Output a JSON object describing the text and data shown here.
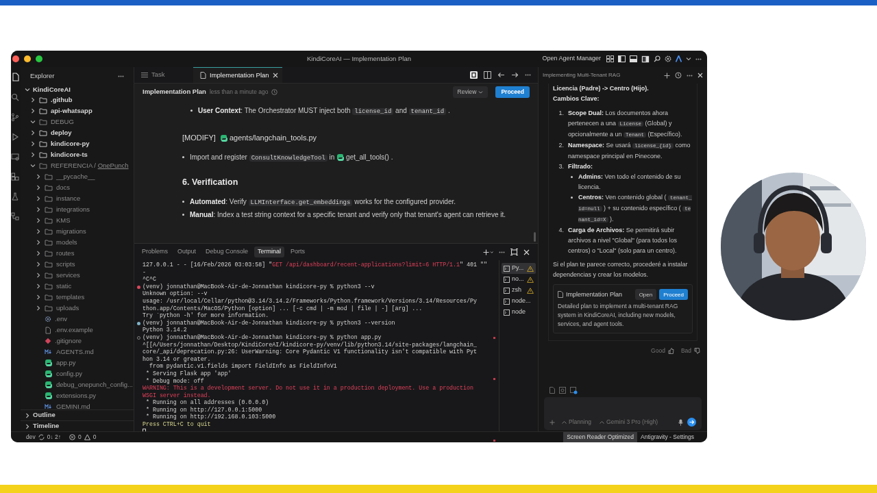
{
  "window": {
    "title": "KindiCoreAI — Implementation Plan",
    "agent_manager": "Open Agent Manager"
  },
  "explorer": {
    "title": "Explorer",
    "root": "KindiCoreAI",
    "items": [
      {
        "label": ".github",
        "kind": "folder",
        "expanded": false,
        "dimmed": false
      },
      {
        "label": "api-whatsapp",
        "kind": "folder",
        "expanded": false,
        "dimmed": false
      },
      {
        "label": "DEBUG",
        "kind": "folder",
        "expanded": true,
        "dimmed": true
      },
      {
        "label": "deploy",
        "kind": "folder",
        "expanded": false,
        "dimmed": false
      },
      {
        "label": "kindicore-py",
        "kind": "folder",
        "expanded": false,
        "dimmed": false
      },
      {
        "label": "kindicore-ts",
        "kind": "folder",
        "expanded": false,
        "dimmed": false
      },
      {
        "label": "REFERENCIA",
        "separator": "/",
        "link": "OnePunch",
        "kind": "folder",
        "expanded": true,
        "dimmed": true,
        "children": [
          {
            "label": "__pycache__",
            "kind": "folder",
            "expanded": false,
            "dimmed": true
          },
          {
            "label": "docs",
            "kind": "folder",
            "expanded": false,
            "dimmed": true
          },
          {
            "label": "instance",
            "kind": "folder",
            "expanded": false,
            "dimmed": true
          },
          {
            "label": "integrations",
            "kind": "folder",
            "expanded": false,
            "dimmed": true
          },
          {
            "label": "KMS",
            "kind": "folder",
            "expanded": false,
            "dimmed": true
          },
          {
            "label": "migrations",
            "kind": "folder",
            "expanded": false,
            "dimmed": true
          },
          {
            "label": "models",
            "kind": "folder",
            "expanded": false,
            "dimmed": true
          },
          {
            "label": "routes",
            "kind": "folder",
            "expanded": false,
            "dimmed": true
          },
          {
            "label": "scripts",
            "kind": "folder",
            "expanded": false,
            "dimmed": true
          },
          {
            "label": "services",
            "kind": "folder",
            "expanded": false,
            "dimmed": true
          },
          {
            "label": "static",
            "kind": "folder",
            "expanded": false,
            "dimmed": true
          },
          {
            "label": "templates",
            "kind": "folder",
            "expanded": false,
            "dimmed": true
          },
          {
            "label": "uploads",
            "kind": "folder",
            "expanded": false,
            "dimmed": true
          },
          {
            "label": ".env",
            "kind": "env",
            "dimmed": true
          },
          {
            "label": ".env.example",
            "kind": "file",
            "dimmed": true
          },
          {
            "label": ".gitignore",
            "kind": "git",
            "dimmed": true
          },
          {
            "label": "AGENTS.md",
            "kind": "markdown",
            "dimmed": true
          },
          {
            "label": "app.py",
            "kind": "python",
            "dimmed": true
          },
          {
            "label": "config.py",
            "kind": "python",
            "dimmed": true
          },
          {
            "label": "debug_onepunch_config...",
            "kind": "python",
            "dimmed": true
          },
          {
            "label": "extensions.py",
            "kind": "python",
            "dimmed": true
          },
          {
            "label": "GEMINI.md",
            "kind": "markdown",
            "dimmed": true
          }
        ]
      }
    ],
    "sections": [
      {
        "label": "Outline",
        "expanded": false
      },
      {
        "label": "Timeline",
        "expanded": false
      }
    ]
  },
  "editor": {
    "tabs": [
      {
        "label": "Task",
        "selected": false
      },
      {
        "label": "Implementation Plan",
        "selected": true
      }
    ],
    "header": {
      "title": "Implementation Plan",
      "time": "less than a minute ago",
      "review": "Review",
      "proceed": "Proceed"
    },
    "blocks": [
      {
        "kind": "sub_bullet",
        "segments": [
          {
            "t": "User Context",
            "kind": "bold"
          },
          {
            "t": ": The Orchestrator MUST inject both "
          },
          {
            "t": "license_id",
            "kind": "code"
          },
          {
            "t": " and "
          },
          {
            "t": "tenant_id",
            "kind": "code"
          },
          {
            "t": " ."
          }
        ]
      },
      {
        "kind": "file_heading",
        "segments": [
          {
            "t": "[MODIFY]"
          },
          {
            "t": "agents/langchain_tools.py",
            "kind": "file"
          }
        ]
      },
      {
        "kind": "bullet",
        "segments": [
          {
            "t": "Import and register "
          },
          {
            "t": "ConsultKnowledgeTool",
            "kind": "code"
          },
          {
            "t": " in "
          },
          {
            "t": "get_all_tools()",
            "kind": "file"
          },
          {
            "t": " ."
          }
        ]
      },
      {
        "kind": "heading",
        "segments": [
          {
            "t": "6. Verification"
          }
        ]
      },
      {
        "kind": "bullet",
        "segments": [
          {
            "t": "Automated",
            "kind": "bold"
          },
          {
            "t": ": Verify "
          },
          {
            "t": "LLMInterface.get_embeddings",
            "kind": "code"
          },
          {
            "t": " works for the configured provider."
          }
        ]
      },
      {
        "kind": "bullet",
        "segments": [
          {
            "t": "Manual",
            "kind": "bold"
          },
          {
            "t": ": Index a test string context for a specific tenant and verify only that tenant's agent can retrieve it."
          }
        ]
      }
    ]
  },
  "panel": {
    "tabs": [
      {
        "label": "Problems",
        "selected": false
      },
      {
        "label": "Output",
        "selected": false
      },
      {
        "label": "Debug Console",
        "selected": false
      },
      {
        "label": "Terminal",
        "selected": true
      },
      {
        "label": "Ports",
        "selected": false
      }
    ],
    "terminal_lines": [
      {
        "kind": "output",
        "segments": [
          {
            "t": "127.0.0.1 - - [16/Feb/2026 03:03:58] \""
          },
          {
            "t": "GET /api/dashboard/recent-applications?limit=6 HTTP/1.1",
            "kind": "error"
          },
          {
            "t": "\" 401 \"\""
          }
        ]
      },
      {
        "kind": "output",
        "segments": [
          {
            "t": "-"
          }
        ]
      },
      {
        "kind": "output",
        "segments": [
          {
            "t": "^C^C"
          }
        ]
      },
      {
        "kind": "prompt_failed",
        "segments": [
          {
            "t": "(venv) jonnathan@MacBook-Air-de-Jonnathan kindicore-py % python3 --v"
          }
        ]
      },
      {
        "kind": "output",
        "segments": [
          {
            "t": "Unknown option: --v"
          }
        ]
      },
      {
        "kind": "output",
        "segments": [
          {
            "t": "usage: /usr/local/Cellar/python@3.14/3.14.2/Frameworks/Python.framework/Versions/3.14/Resources/Py"
          }
        ]
      },
      {
        "kind": "output",
        "segments": [
          {
            "t": "thon.app/Contents/MacOS/Python [option] ... [-c cmd | -m mod | file | -] [arg] ..."
          }
        ]
      },
      {
        "kind": "output",
        "segments": [
          {
            "t": "Try `python -h' for more information."
          }
        ]
      },
      {
        "kind": "prompt_ok",
        "segments": [
          {
            "t": "(venv) jonnathan@MacBook-Air-de-Jonnathan kindicore-py % python3 --version"
          }
        ]
      },
      {
        "kind": "output",
        "segments": [
          {
            "t": "Python 3.14.2"
          }
        ]
      },
      {
        "kind": "prompt_running",
        "segments": [
          {
            "t": "(venv) jonnathan@MacBook-Air-de-Jonnathan kindicore-py % python app.py"
          }
        ]
      },
      {
        "kind": "output",
        "segments": [
          {
            "t": "^[[A/Users/jonnathan/Desktop/KindiCoreAI/kindicore-py/venv/lib/python3.14/site-packages/langchain_"
          }
        ]
      },
      {
        "kind": "output",
        "segments": [
          {
            "t": "core/_api/deprecation.py:26: UserWarning: Core Pydantic V1 functionality isn't compatible with Pyt"
          }
        ]
      },
      {
        "kind": "output",
        "segments": [
          {
            "t": "hon 3.14 or greater."
          }
        ]
      },
      {
        "kind": "output",
        "segments": [
          {
            "t": "  from pydantic.v1.fields import FieldInfo as FieldInfoV1"
          }
        ]
      },
      {
        "kind": "output",
        "segments": [
          {
            "t": " * Serving Flask app 'app'"
          }
        ]
      },
      {
        "kind": "output",
        "segments": [
          {
            "t": " * Debug mode: off"
          }
        ]
      },
      {
        "kind": "output",
        "segments": [
          {
            "t": "WARNING: This is a development server. Do not use it in a production deployment. Use a production",
            "kind": "error"
          }
        ]
      },
      {
        "kind": "output",
        "segments": [
          {
            "t": "WSGI server instead.",
            "kind": "error"
          }
        ]
      },
      {
        "kind": "output",
        "segments": [
          {
            "t": " * Running on all addresses (0.0.0.0)"
          }
        ]
      },
      {
        "kind": "output",
        "segments": [
          {
            "t": " * Running on http://127.0.0.1:5000"
          }
        ]
      },
      {
        "kind": "output",
        "segments": [
          {
            "t": " * Running on http://192.168.0.103:5000"
          }
        ]
      },
      {
        "kind": "output",
        "segments": [
          {
            "t": "Press CTRL+C to quit",
            "kind": "notice"
          }
        ]
      }
    ],
    "sessions": [
      {
        "label": "Py...",
        "warning": true,
        "selected": true
      },
      {
        "label": "no...",
        "warning": true,
        "selected": false
      },
      {
        "label": "zsh",
        "warning": true,
        "selected": false
      },
      {
        "label": "node...",
        "warning": false,
        "selected": false
      },
      {
        "label": "node",
        "warning": false,
        "selected": false
      }
    ]
  },
  "agent": {
    "title": "Implementing Multi-Tenant RAG",
    "intro": [
      "Licencia (Padre) -> Centro (Hijo).",
      "Cambios Clave:"
    ],
    "steps": [
      {
        "number": "1.",
        "segments": [
          {
            "t": "Scope Dual:",
            "kind": "bold"
          },
          {
            "t": " Los documentos ahora pertenecen a una "
          },
          {
            "t": "License",
            "kind": "code"
          },
          {
            "t": " (Global) y opcionalmente a un "
          },
          {
            "t": "Tenant",
            "kind": "code"
          },
          {
            "t": " (Específico)."
          }
        ]
      },
      {
        "number": "2.",
        "segments": [
          {
            "t": "Namespace:",
            "kind": "bold"
          },
          {
            "t": " Se usará "
          },
          {
            "t": "license_{id}",
            "kind": "code"
          },
          {
            "t": " como namespace principal en Pinecone."
          }
        ]
      },
      {
        "number": "3.",
        "segments": [
          {
            "t": "Filtrado:",
            "kind": "bold"
          }
        ],
        "children": [
          {
            "segments": [
              {
                "t": "Admins:",
                "kind": "bold"
              },
              {
                "t": " Ven todo el contenido de su licencia."
              }
            ]
          },
          {
            "segments": [
              {
                "t": "Centros:",
                "kind": "bold"
              },
              {
                "t": " Ven contenido global ( "
              },
              {
                "t": "tenant_id=null",
                "kind": "code"
              },
              {
                "t": " ) + su contenido específico ( "
              },
              {
                "t": "tenant_id=X",
                "kind": "code"
              },
              {
                "t": " )."
              }
            ]
          }
        ]
      },
      {
        "number": "4.",
        "segments": [
          {
            "t": "Carga de Archivos:",
            "kind": "bold"
          },
          {
            "t": " Se permitirá subir archivos a nivel \"Global\" (para todos los centros) o \"Local\" (solo para un centro)."
          }
        ]
      }
    ],
    "closing": "Si el plan te parece correcto, procederé a instalar dependencias y crear los modelos.",
    "card": {
      "title": "Implementation Plan",
      "open": "Open",
      "proceed": "Proceed",
      "description": "Detailed plan to implement a multi-tenant RAG system in KindiCoreAI, including new models, services, and agent tools."
    },
    "feedback": [
      "Good",
      "Bad"
    ],
    "input": {
      "mode": "Planning",
      "model": "Gemini 3 Pro (High)"
    }
  },
  "status_bar": {
    "branch": "dev",
    "sync": "0↓ 2↑",
    "errors": "0",
    "warnings": "0",
    "right": [
      {
        "label": "Screen Reader Optimized",
        "highlighted": true
      },
      {
        "label": "Antigravity - Settings",
        "highlighted": false
      }
    ]
  }
}
